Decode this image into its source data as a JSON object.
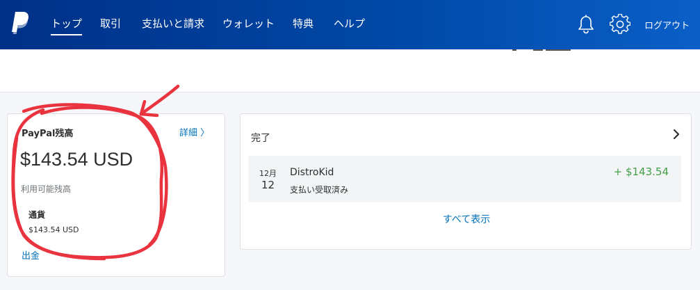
{
  "nav": {
    "items": [
      {
        "label": "トップ",
        "active": true
      },
      {
        "label": "取引"
      },
      {
        "label": "支払いと請求"
      },
      {
        "label": "ウォレット"
      },
      {
        "label": "特典"
      },
      {
        "label": "ヘルプ"
      }
    ],
    "logout": "ログアウト"
  },
  "balance": {
    "title": "PayPal残高",
    "detail_link": "詳細 〉",
    "amount": "$143.54 USD",
    "subtitle": "利用可能残高",
    "currency_label": "通貨",
    "currency_value": "$143.54 USD",
    "withdraw": "出金"
  },
  "activity": {
    "title": "完了",
    "transactions": [
      {
        "month": "12月",
        "day": "12",
        "name": "DistroKid",
        "status": "支払い受取済み",
        "amount": "+ $143.54"
      }
    ],
    "show_all": "すべて表示"
  },
  "colors": {
    "header_start": "#003087",
    "header_end": "#0a5fc7",
    "link": "#0070ba",
    "positive_amount": "#43a047",
    "annotation_stroke": "#e9333f"
  },
  "icons": [
    "paypal-logo",
    "bell-icon",
    "gear-icon",
    "chevron-right-icon"
  ]
}
